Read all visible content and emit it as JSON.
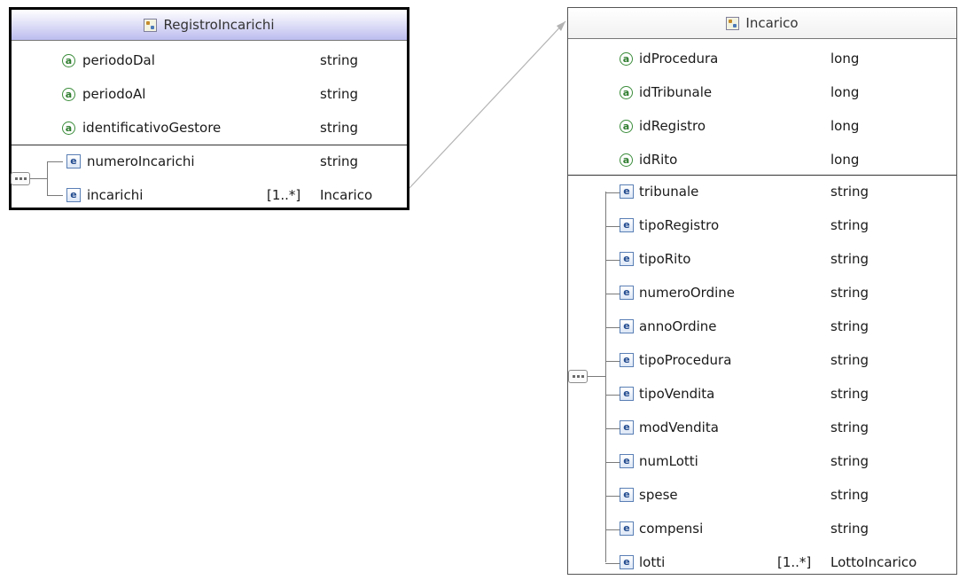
{
  "registro": {
    "title": "RegistroIncarichi",
    "attributes": [
      {
        "name": "periodoDal",
        "type": "string"
      },
      {
        "name": "periodoAl",
        "type": "string"
      },
      {
        "name": "identificativoGestore",
        "type": "string"
      }
    ],
    "elements": [
      {
        "name": "numeroIncarichi",
        "cardinality": "",
        "type": "string"
      },
      {
        "name": "incarichi",
        "cardinality": "[1..*]",
        "type": "Incarico"
      }
    ]
  },
  "incarico": {
    "title": "Incarico",
    "attributes": [
      {
        "name": "idProcedura",
        "type": "long"
      },
      {
        "name": "idTribunale",
        "type": "long"
      },
      {
        "name": "idRegistro",
        "type": "long"
      },
      {
        "name": "idRito",
        "type": "long"
      }
    ],
    "elements": [
      {
        "name": "tribunale",
        "cardinality": "",
        "type": "string"
      },
      {
        "name": "tipoRegistro",
        "cardinality": "",
        "type": "string"
      },
      {
        "name": "tipoRito",
        "cardinality": "",
        "type": "string"
      },
      {
        "name": "numeroOrdine",
        "cardinality": "",
        "type": "string"
      },
      {
        "name": "annoOrdine",
        "cardinality": "",
        "type": "string"
      },
      {
        "name": "tipoProcedura",
        "cardinality": "",
        "type": "string"
      },
      {
        "name": "tipoVendita",
        "cardinality": "",
        "type": "string"
      },
      {
        "name": "modVendita",
        "cardinality": "",
        "type": "string"
      },
      {
        "name": "numLotti",
        "cardinality": "",
        "type": "string"
      },
      {
        "name": "spese",
        "cardinality": "",
        "type": "string"
      },
      {
        "name": "compensi",
        "cardinality": "",
        "type": "string"
      },
      {
        "name": "lotti",
        "cardinality": "[1..*]",
        "type": "LottoIncarico"
      }
    ]
  },
  "icons": {
    "type_header": "complex-type-icon",
    "attribute": "attribute-icon",
    "element": "element-icon",
    "sequence": "sequence-icon"
  }
}
